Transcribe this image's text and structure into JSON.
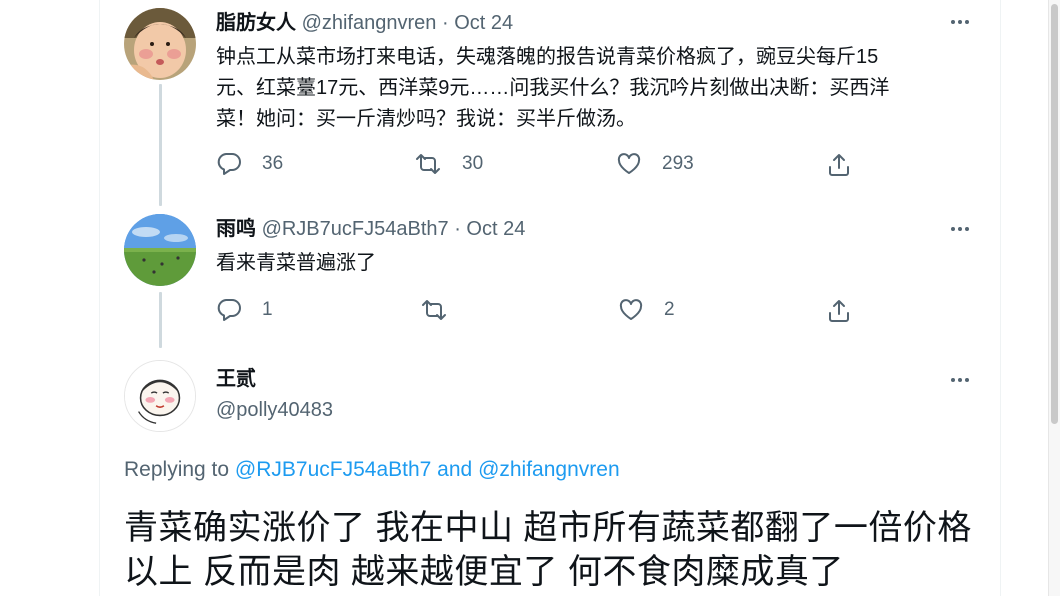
{
  "tweets": [
    {
      "author_name": "脂肪女人",
      "handle": "@zhifangnvren",
      "separator": "·",
      "date": "Oct 24",
      "text_lines": [
        "钟点工从菜市场打来电话，失魂落魄的报告说青菜价格疯了，豌豆尖每斤15",
        "元、红菜薹17元、西洋菜9元……问我买什么？我沉吟片刻做出决断：买西洋",
        "菜！她问：买一斤清炒吗？我说：买半斤做汤。"
      ],
      "replies": "36",
      "retweets": "30",
      "likes": "293"
    },
    {
      "author_name": "雨鸣",
      "handle": "@RJB7ucFJ54aBth7",
      "separator": "·",
      "date": "Oct 24",
      "text_lines": [
        "看来青菜普遍涨了"
      ],
      "replies": "1",
      "retweets": "",
      "likes": "2"
    }
  ],
  "focused_tweet": {
    "author_name": "王贰",
    "handle": "@polly40483",
    "replying_prefix": "Replying to",
    "replying_handle_1": "@RJB7ucFJ54aBth7",
    "replying_and": "and",
    "replying_handle_2": "@zhifangnvren",
    "text_lines": [
      "青菜确实涨价了 我在中山 超市所有蔬菜都翻了一倍价格",
      "以上 反而是肉 越来越便宜了 何不食肉糜成真了"
    ]
  },
  "colors": {
    "text_primary": "#0f1419",
    "text_secondary": "#536471",
    "link": "#1d9bf0",
    "thread_line": "#cfd9de"
  },
  "icons": [
    "reply-icon",
    "retweet-icon",
    "like-icon",
    "share-icon",
    "more-icon"
  ]
}
